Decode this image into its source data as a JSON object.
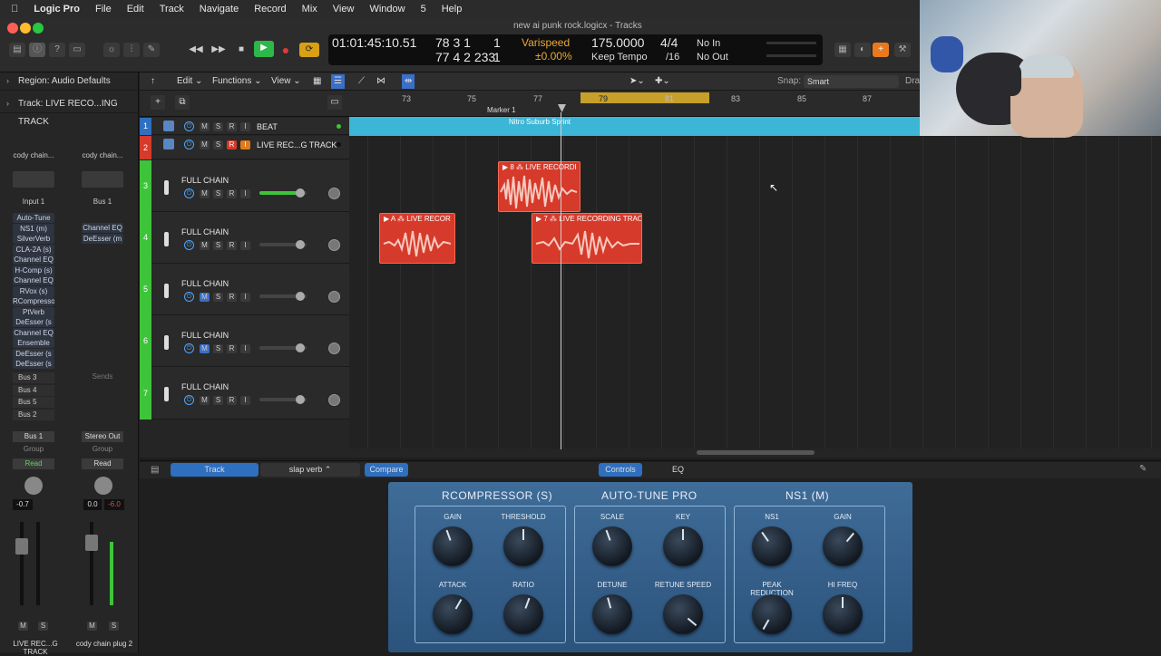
{
  "menubar": {
    "app": "Logic Pro",
    "items": [
      "File",
      "Edit",
      "Track",
      "Navigate",
      "Record",
      "Mix",
      "View",
      "Window",
      "5",
      "Help"
    ]
  },
  "window": {
    "title": "new ai punk rock.logicx - Tracks"
  },
  "lcd": {
    "position": "01:01:45:10.51",
    "bars_top": "78  3  1",
    "beat_top": "1",
    "bars_bot": "77  4  2  233",
    "beat_bot": "1",
    "varispeed": "Varispeed",
    "vari_value": "±0.00%",
    "tempo": "175.0000",
    "keep_tempo": "Keep Tempo",
    "sig": "4/4",
    "div": "/16",
    "in": "No In",
    "out": "No Out"
  },
  "inspector": {
    "region": "Region: Audio Defaults",
    "track": "Track:  LIVE RECO...ING TRACK",
    "strip1": {
      "setting": "cody chain...",
      "input": "Input 1",
      "plugins": [
        "Auto-Tune",
        "NS1 (m)",
        "SilverVerb",
        "CLA-2A (s)",
        "Channel EQ",
        "H-Comp (s)",
        "Channel EQ",
        "RVox (s)",
        "RCompresso",
        "PtVerb",
        "DeEsser (s",
        "Channel EQ",
        "Ensemble",
        "DeEsser (s",
        "DeEsser (s"
      ],
      "sends": [
        "Bus 3",
        "Bus 4",
        "Bus 5",
        "Bus 2"
      ],
      "output": "Bus 1",
      "group": "Group",
      "auto": "Read",
      "vol": "-0.7",
      "name": "LIVE REC...G TRACK"
    },
    "strip2": {
      "setting": "cody chain...",
      "input": "Bus 1",
      "plugins": [
        "Channel EQ",
        "DeEsser (m"
      ],
      "sends": "Sends",
      "output": "Stereo Out",
      "group": "Group",
      "auto": "Read",
      "vol": "0.0",
      "peak": "-6.0",
      "name": "cody chain plug 2"
    }
  },
  "arrange": {
    "edit": "Edit",
    "functions": "Functions",
    "view": "View",
    "snap_label": "Snap:",
    "snap": "Smart",
    "drag": "Dra",
    "ruler": [
      "73",
      "75",
      "77",
      "79",
      "81",
      "83",
      "85",
      "87"
    ],
    "marker": "Marker 1",
    "beat_region": "Nitro Suburb Sprint",
    "tracks": [
      {
        "num": "1",
        "name": "BEAT"
      },
      {
        "num": "2",
        "name": "LIVE REC...G TRACK"
      },
      {
        "num": "3",
        "name": "FULL CHAIN"
      },
      {
        "num": "4",
        "name": "FULL CHAIN"
      },
      {
        "num": "5",
        "name": "FULL CHAIN"
      },
      {
        "num": "6",
        "name": "FULL CHAIN"
      },
      {
        "num": "7",
        "name": "FULL CHAIN"
      }
    ],
    "regions": [
      {
        "label": "▶ 8  ⁂  LIVE RECORDI"
      },
      {
        "label": "▶ A  ⁂  LIVE RECOR"
      },
      {
        "label": "▶ 7  ⁂  LIVE RECORDING TRAC"
      }
    ]
  },
  "smart": {
    "track": "Track",
    "preset": "slap verb",
    "compare": "Compare",
    "controls": "Controls",
    "eq": "EQ"
  },
  "plugin": {
    "sections": [
      {
        "title": "RCOMPRESSOR (S)",
        "knobs": [
          "GAIN",
          "THRESHOLD",
          "ATTACK",
          "RATIO"
        ]
      },
      {
        "title": "AUTO-TUNE PRO",
        "knobs": [
          "SCALE",
          "KEY",
          "DETUNE",
          "RETUNE SPEED"
        ]
      },
      {
        "title": "NS1 (M)",
        "knobs": [
          "NS1",
          "GAIN",
          "PEAK REDUCTION",
          "HI FREQ"
        ]
      }
    ]
  },
  "colors": {
    "green": "#3ec43a",
    "region": "#d63a2a",
    "cyan": "#3ab8d8",
    "blue": "#2f6fbf"
  }
}
